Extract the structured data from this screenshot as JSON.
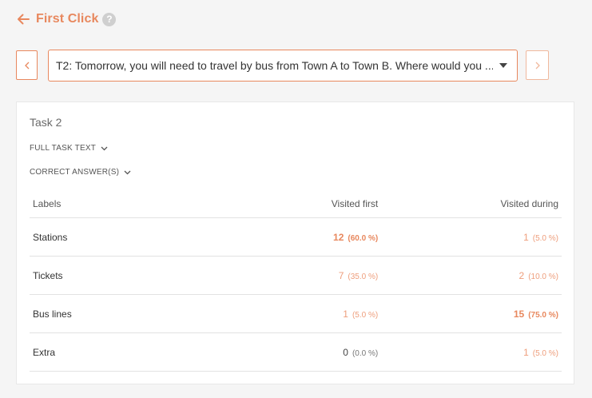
{
  "header": {
    "title": "First Click",
    "help": "?"
  },
  "task_selector": {
    "selected": "T2: Tomorrow, you will need to travel by bus from Town A to Town B. Where would you ..."
  },
  "card": {
    "task_heading": "Task 2",
    "full_task_text_label": "FULL TASK TEXT",
    "correct_answers_label": "CORRECT ANSWER(S)"
  },
  "table": {
    "headers": {
      "labels": "Labels",
      "visited_first": "Visited first",
      "visited_during": "Visited during"
    },
    "rows": [
      {
        "label": "Stations",
        "first_count": "12",
        "first_pct": "(60.0 %)",
        "during_count": "1",
        "during_pct": "(5.0 %)"
      },
      {
        "label": "Tickets",
        "first_count": "7",
        "first_pct": "(35.0 %)",
        "during_count": "2",
        "during_pct": "(10.0 %)"
      },
      {
        "label": "Bus lines",
        "first_count": "1",
        "first_pct": "(5.0 %)",
        "during_count": "15",
        "during_pct": "(75.0 %)"
      },
      {
        "label": "Extra",
        "first_count": "0",
        "first_pct": "(0.0 %)",
        "during_count": "1",
        "during_pct": "(5.0 %)"
      }
    ]
  },
  "colors": {
    "accent": "#e8885e",
    "accent_light": "#ee9e7c"
  }
}
